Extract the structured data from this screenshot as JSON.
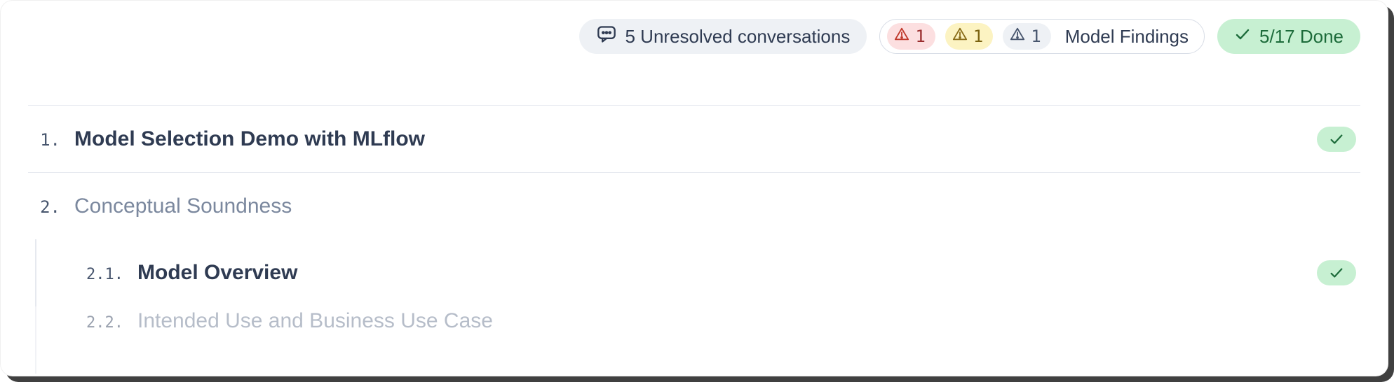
{
  "topbar": {
    "conversations_label": "5 Unresolved conversations",
    "findings": {
      "red_count": "1",
      "yellow_count": "1",
      "grey_count": "1",
      "label": "Model Findings"
    },
    "done_label": "5/17 Done"
  },
  "sections": {
    "s1": {
      "num": "1.",
      "title": "Model Selection Demo with MLflow",
      "done": true
    },
    "s2": {
      "num": "2.",
      "title": "Conceptual Soundness"
    },
    "s2_1": {
      "num": "2.1.",
      "title": "Model Overview",
      "done": true
    },
    "s2_2": {
      "num": "2.2.",
      "title": "Intended Use and Business Use Case"
    }
  }
}
